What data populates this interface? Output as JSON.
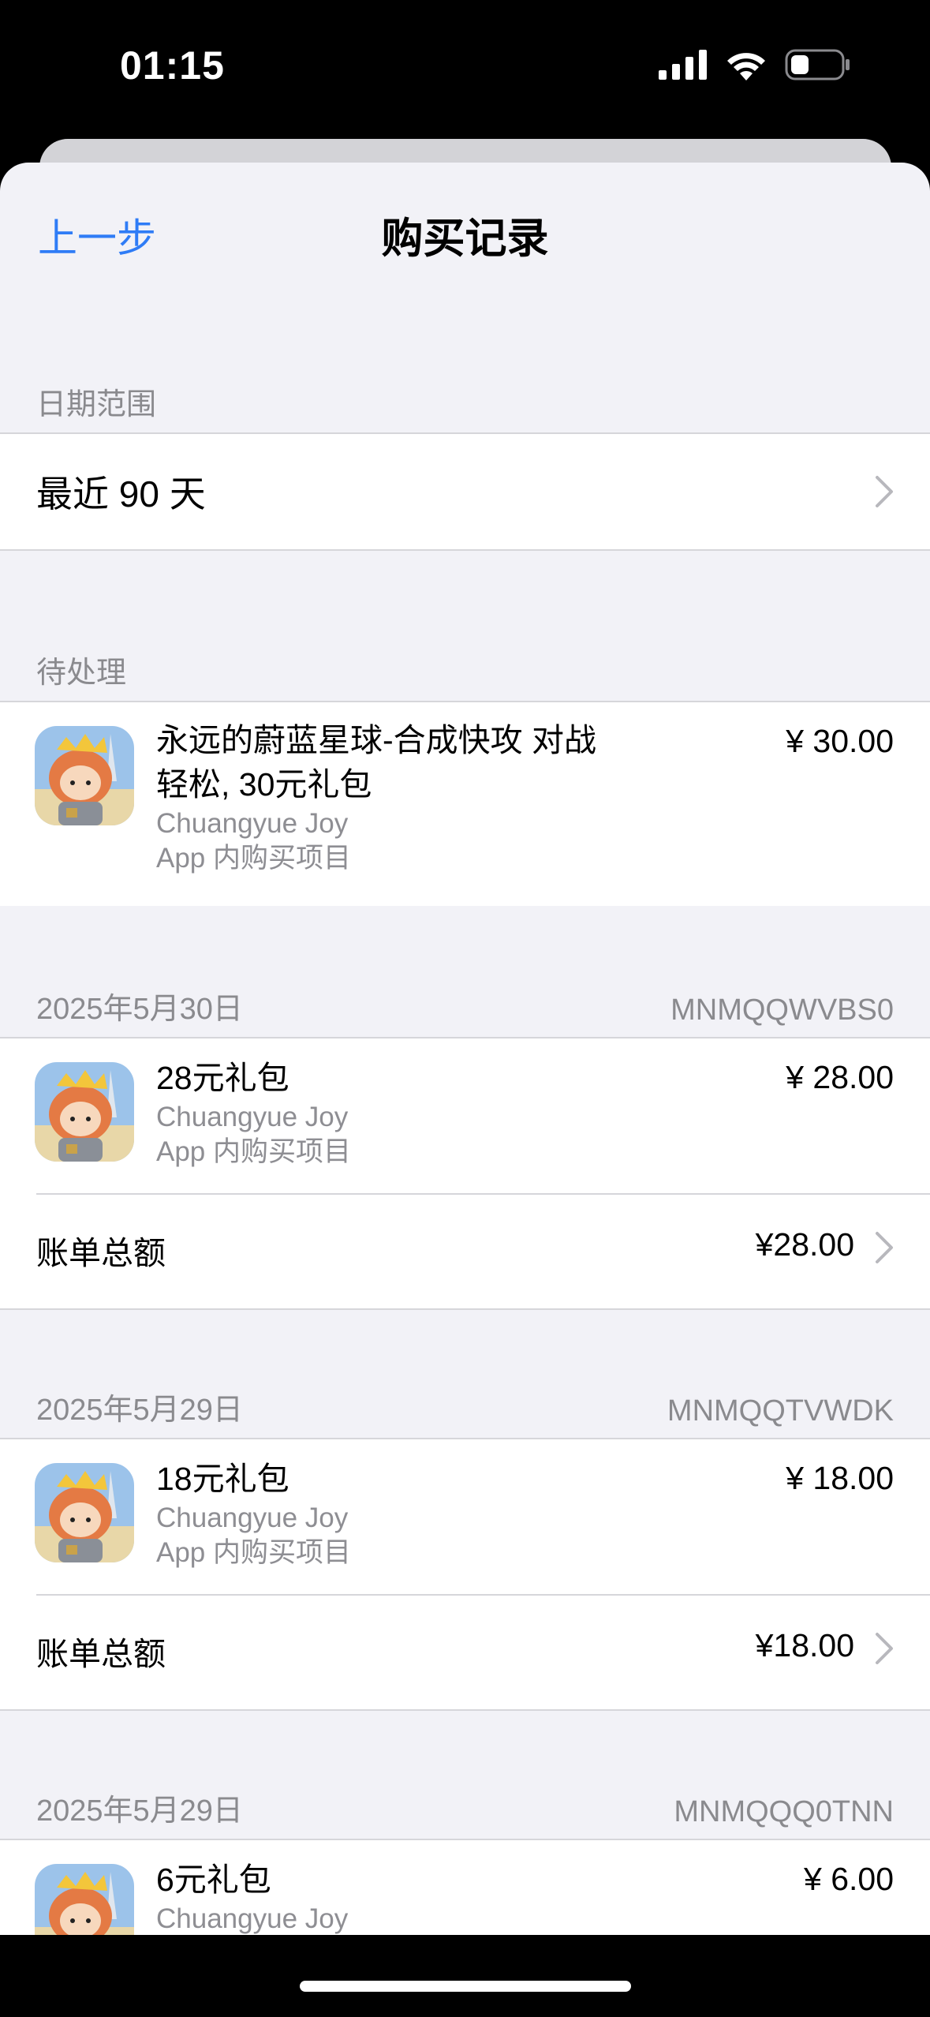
{
  "status_bar": {
    "time": "01:15"
  },
  "nav": {
    "back_label": "上一步",
    "title": "购买记录"
  },
  "date_range": {
    "header": "日期范围",
    "value": "最近 90 天"
  },
  "pending": {
    "header": "待处理",
    "item": {
      "title_line1": "永远的蔚蓝星球-合成快攻 对战",
      "title_line2": "轻松, 30元礼包",
      "developer": "Chuangyue Joy",
      "type": "App 内购买项目",
      "price": "¥ 30.00"
    }
  },
  "orders": [
    {
      "date": "2025年5月30日",
      "order_id": "MNMQQWVBS0",
      "item": {
        "title": "28元礼包",
        "developer": "Chuangyue Joy",
        "type": "App 内购买项目",
        "price": "¥ 28.00"
      },
      "total_label": "账单总额",
      "total_value": "¥28.00"
    },
    {
      "date": "2025年5月29日",
      "order_id": "MNMQQTVWDK",
      "item": {
        "title": "18元礼包",
        "developer": "Chuangyue Joy",
        "type": "App 内购买项目",
        "price": "¥ 18.00"
      },
      "total_label": "账单总额",
      "total_value": "¥18.00"
    },
    {
      "date": "2025年5月29日",
      "order_id": "MNMQQQ0TNN",
      "item": {
        "title": "6元礼包",
        "developer": "Chuangyue Joy",
        "price": "¥ 6.00"
      }
    }
  ],
  "colors": {
    "accent": "#2f7cf6",
    "background": "#f2f2f7",
    "secondary_text": "#8e8e93"
  },
  "icons": [
    "cellular-signal-icon",
    "wifi-icon",
    "battery-icon",
    "chevron-right-icon",
    "app-icon"
  ]
}
